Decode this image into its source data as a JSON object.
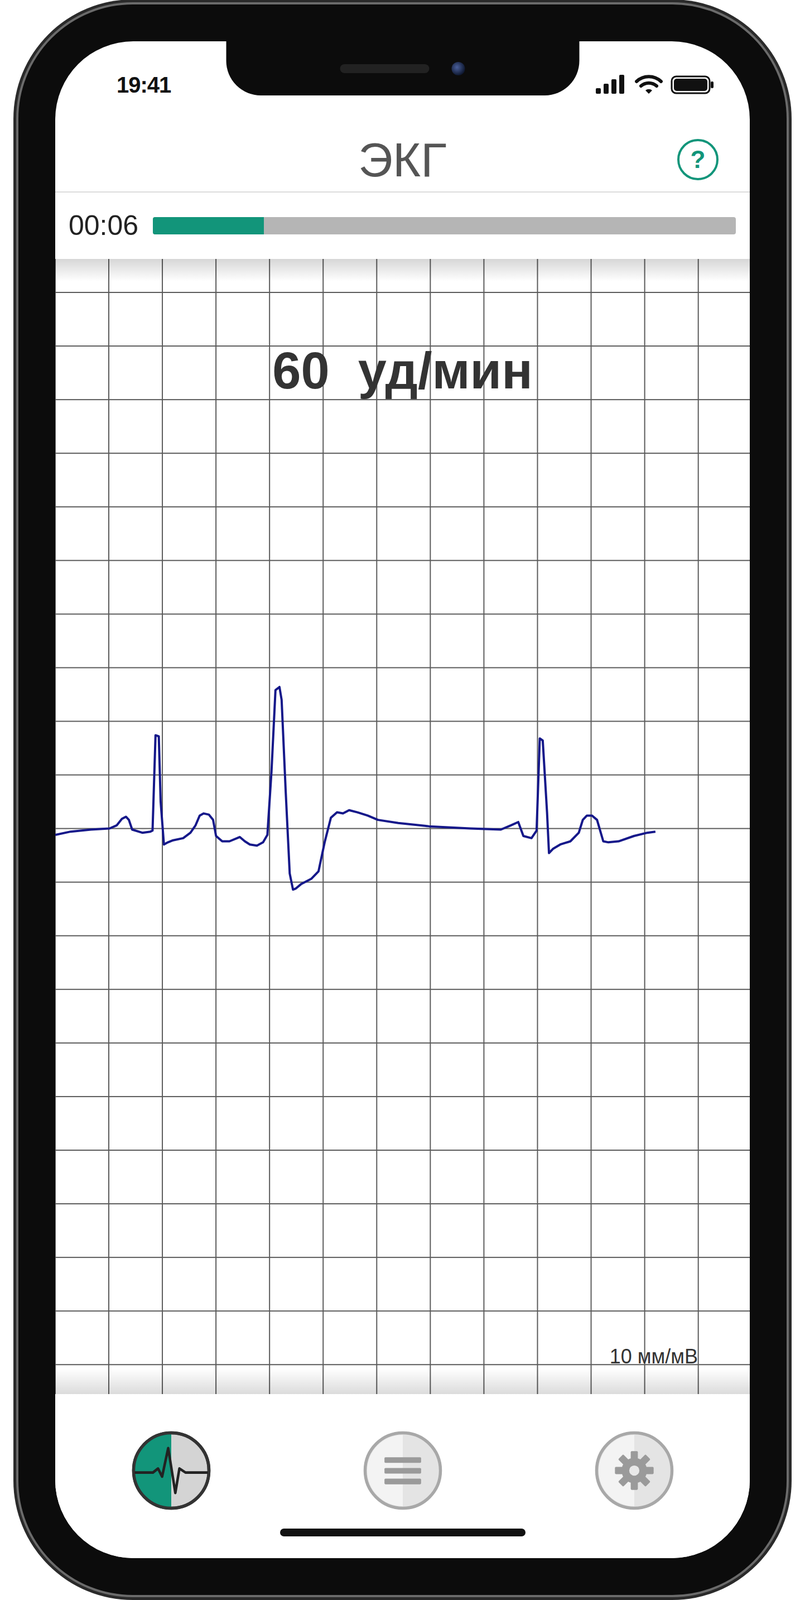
{
  "status_bar": {
    "time": "19:41",
    "signal_level": 1,
    "battery_level": 1
  },
  "header": {
    "title": "ЭКГ",
    "help": "?"
  },
  "recording": {
    "elapsed": "00:06",
    "level": 0.19
  },
  "ecg": {
    "rate": "60  уд/мин",
    "scale": "10 мм/мВ",
    "trace": {
      "t": [
        0,
        0.057,
        0.133,
        0.202,
        0.229,
        0.248,
        0.263,
        0.274,
        0.286,
        0.324,
        0.354,
        0.362,
        0.373,
        0.385,
        0.392,
        0.404,
        0.419,
        0.438,
        0.476,
        0.503,
        0.522,
        0.537,
        0.552,
        0.571,
        0.587,
        0.598,
        0.621,
        0.648,
        0.686,
        0.705,
        0.724,
        0.75,
        0.773,
        0.789,
        0.804,
        0.819,
        0.834,
        0.842,
        0.857,
        0.872,
        0.884,
        0.895,
        0.914,
        0.952,
        0.979,
        1.002,
        1.025,
        1.048,
        1.07,
        1.093,
        1.124,
        1.162,
        1.2,
        1.276,
        1.39,
        1.543,
        1.657,
        1.695,
        1.722,
        1.741,
        1.771,
        1.79,
        1.802,
        1.813,
        1.829,
        1.836,
        1.851,
        1.878,
        1.916,
        1.947,
        1.962,
        1.977,
        1.996,
        2.015,
        2.038,
        2.057,
        2.095,
        2.152,
        2.202,
        2.232
      ],
      "values": [
        -0.04,
        -0.01,
        0.01,
        0.02,
        0.05,
        0.11,
        0.13,
        0.1,
        0.01,
        -0.02,
        -0.01,
        0,
        0.89,
        0.88,
        0.27,
        -0.13,
        -0.11,
        -0.09,
        -0.07,
        -0.02,
        0.05,
        0.14,
        0.16,
        0.15,
        0.1,
        -0.05,
        -0.1,
        -0.1,
        -0.06,
        -0.1,
        -0.13,
        -0.14,
        -0.11,
        -0.04,
        0.55,
        1.31,
        1.34,
        1.22,
        0.36,
        -0.4,
        -0.55,
        -0.54,
        -0.5,
        -0.45,
        -0.38,
        -0.11,
        0.12,
        0.17,
        0.16,
        0.19,
        0.17,
        0.14,
        0.1,
        0.07,
        0.04,
        0.02,
        0.01,
        0.05,
        0.08,
        -0.05,
        -0.07,
        0,
        0.86,
        0.84,
        0.17,
        -0.21,
        -0.17,
        -0.13,
        -0.1,
        -0.02,
        0.1,
        0.14,
        0.14,
        0.1,
        -0.1,
        -0.11,
        -0.1,
        -0.05,
        -0.02,
        -0.01
      ]
    }
  },
  "tabs": [
    {
      "kind": "ecg",
      "selected": true
    },
    {
      "kind": "list",
      "selected": false
    },
    {
      "kind": "settings",
      "selected": false
    }
  ]
}
